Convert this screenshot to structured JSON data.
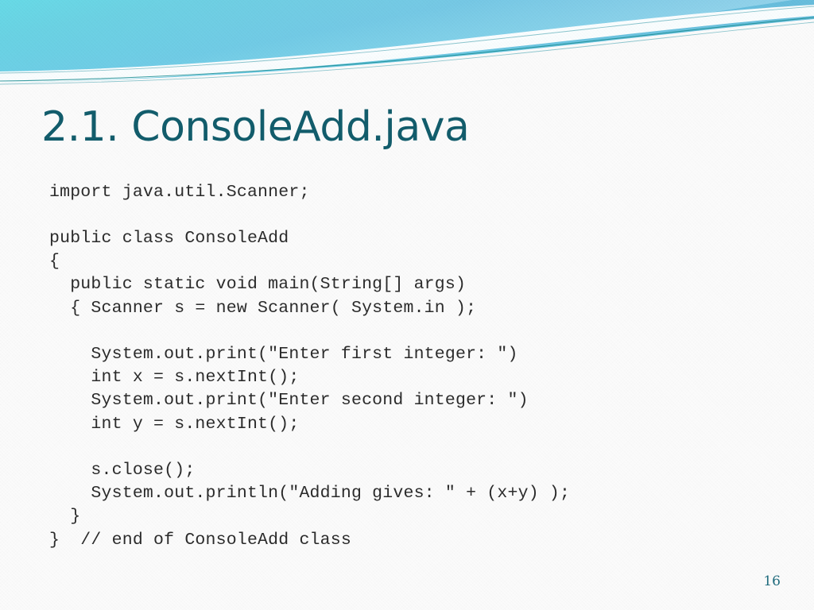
{
  "slide": {
    "title": "2.1. ConsoleAdd.java",
    "page_number": "16",
    "colors": {
      "title_text": "#125c6b",
      "code_text": "#2b2b2b",
      "page_number": "#1f6b7d",
      "background": "#fbfbfb",
      "wave_cyan_light": "#7fe3ea",
      "wave_cyan": "#5ecfdd",
      "wave_blue_light": "#a9dcef",
      "wave_blue": "#6ec6e4",
      "wave_blue_deep": "#4fb3d4",
      "wave_teal_line": "#1f8f94"
    }
  },
  "code": {
    "language": "java",
    "file_name": "ConsoleAdd.java",
    "lines": [
      "import java.util.Scanner;",
      "",
      "public class ConsoleAdd",
      "{",
      "  public static void main(String[] args)",
      "  { Scanner s = new Scanner( System.in );",
      "",
      "    System.out.print(\"Enter first integer: \")",
      "    int x = s.nextInt();",
      "    System.out.print(\"Enter second integer: \")",
      "    int y = s.nextInt();",
      "",
      "    s.close();",
      "    System.out.println(\"Adding gives: \" + (x+y) );",
      "  }",
      "}  // end of ConsoleAdd class"
    ]
  }
}
